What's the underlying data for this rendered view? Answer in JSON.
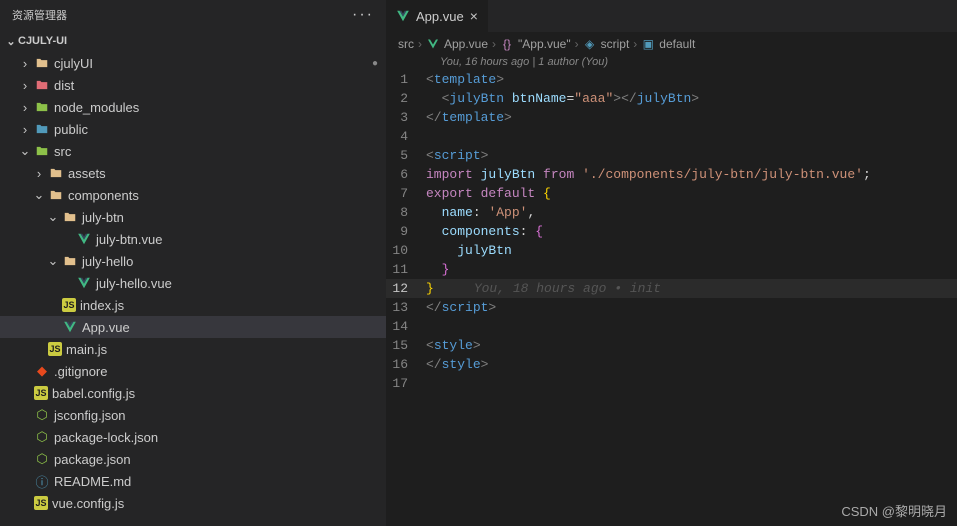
{
  "sidebar": {
    "title": "资源管理器",
    "project": "CJULY-UI",
    "items": [
      {
        "depth": 1,
        "chev": "›",
        "iconColor": "#e2c08d",
        "label": "cjulyUI",
        "modified": true
      },
      {
        "depth": 1,
        "chev": "›",
        "iconColor": "#e06c75",
        "label": "dist"
      },
      {
        "depth": 1,
        "chev": "›",
        "iconColor": "#8dc149",
        "label": "node_modules"
      },
      {
        "depth": 1,
        "chev": "›",
        "iconColor": "#519aba",
        "label": "public"
      },
      {
        "depth": 1,
        "chev": "⌄",
        "iconColor": "#8dc149",
        "label": "src"
      },
      {
        "depth": 2,
        "chev": "›",
        "iconColor": "#e2c08d",
        "label": "assets"
      },
      {
        "depth": 2,
        "chev": "⌄",
        "iconColor": "#e2c08d",
        "label": "components"
      },
      {
        "depth": 3,
        "chev": "⌄",
        "iconColor": "#e2c08d",
        "label": "july-btn"
      },
      {
        "depth": 4,
        "chev": "",
        "iconType": "vue",
        "label": "july-btn.vue"
      },
      {
        "depth": 3,
        "chev": "⌄",
        "iconColor": "#e2c08d",
        "label": "july-hello"
      },
      {
        "depth": 4,
        "chev": "",
        "iconType": "vue",
        "label": "july-hello.vue"
      },
      {
        "depth": 3,
        "chev": "",
        "iconType": "js",
        "label": "index.js"
      },
      {
        "depth": 3,
        "chev": "",
        "iconType": "vue",
        "label": "App.vue",
        "active": true
      },
      {
        "depth": 2,
        "chev": "",
        "iconType": "js",
        "label": "main.js"
      },
      {
        "depth": 1,
        "chev": "",
        "iconType": "git",
        "label": ".gitignore"
      },
      {
        "depth": 1,
        "chev": "",
        "iconType": "js",
        "label": "babel.config.js"
      },
      {
        "depth": 1,
        "chev": "",
        "iconType": "json",
        "label": "jsconfig.json"
      },
      {
        "depth": 1,
        "chev": "",
        "iconType": "json",
        "label": "package-lock.json"
      },
      {
        "depth": 1,
        "chev": "",
        "iconType": "json",
        "label": "package.json"
      },
      {
        "depth": 1,
        "chev": "",
        "iconType": "md",
        "label": "README.md"
      },
      {
        "depth": 1,
        "chev": "",
        "iconType": "js",
        "label": "vue.config.js"
      }
    ]
  },
  "tabs": [
    {
      "icon": "vue",
      "label": "App.vue"
    }
  ],
  "breadcrumb": {
    "parts": [
      "src",
      "App.vue",
      "\"App.vue\"",
      "script",
      "default"
    ],
    "icons": [
      "",
      "vue",
      "braces",
      "cube",
      "bracket"
    ]
  },
  "blameTop": "You, 16 hours ago | 1 author (You)",
  "code": {
    "lines": [
      {
        "n": 1,
        "html": "<span class='tk-tag'>&lt;</span><span class='tk-el'>template</span><span class='tk-tag'>&gt;</span>"
      },
      {
        "n": 2,
        "html": "  <span class='tk-tag'>&lt;</span><span class='tk-el'>julyBtn</span> <span class='tk-attr'>btnName</span><span class='tk-pun'>=</span><span class='tk-str'>\"aaa\"</span><span class='tk-tag'>&gt;&lt;/</span><span class='tk-el'>julyBtn</span><span class='tk-tag'>&gt;</span>"
      },
      {
        "n": 3,
        "html": "<span class='tk-tag'>&lt;/</span><span class='tk-el'>template</span><span class='tk-tag'>&gt;</span>"
      },
      {
        "n": 4,
        "html": ""
      },
      {
        "n": 5,
        "html": "<span class='tk-tag'>&lt;</span><span class='tk-el'>script</span><span class='tk-tag'>&gt;</span>"
      },
      {
        "n": 6,
        "html": "<span class='tk-kw'>import</span> <span class='tk-id'>julyBtn</span> <span class='tk-kw'>from</span> <span class='tk-str'>'./components/july-btn/july-btn.vue'</span><span class='tk-pun'>;</span>"
      },
      {
        "n": 7,
        "html": "<span class='tk-kw'>export</span> <span class='tk-kw'>default</span> <span class='tk-brace'>{</span>"
      },
      {
        "n": 8,
        "html": "  <span class='tk-prop'>name</span><span class='tk-pun'>:</span> <span class='tk-str'>'App'</span><span class='tk-pun'>,</span>"
      },
      {
        "n": 9,
        "html": "  <span class='tk-prop'>components</span><span class='tk-pun'>:</span> <span class='tk-brace2'>{</span>"
      },
      {
        "n": 10,
        "html": "    <span class='tk-id'>julyBtn</span>"
      },
      {
        "n": 11,
        "html": "  <span class='tk-brace2'>}</span>"
      },
      {
        "n": 12,
        "html": "<span class='tk-brace'>}</span><span class='blame-inline'>You, 18 hours ago • init</span>",
        "active": true
      },
      {
        "n": 13,
        "html": "<span class='tk-tag'>&lt;/</span><span class='tk-el'>script</span><span class='tk-tag'>&gt;</span>"
      },
      {
        "n": 14,
        "html": ""
      },
      {
        "n": 15,
        "html": "<span class='tk-tag'>&lt;</span><span class='tk-el'>style</span><span class='tk-tag'>&gt;</span>"
      },
      {
        "n": 16,
        "html": "<span class='tk-tag'>&lt;/</span><span class='tk-el'>style</span><span class='tk-tag'>&gt;</span>"
      },
      {
        "n": 17,
        "html": ""
      }
    ]
  },
  "watermark": "CSDN @黎明晓月"
}
